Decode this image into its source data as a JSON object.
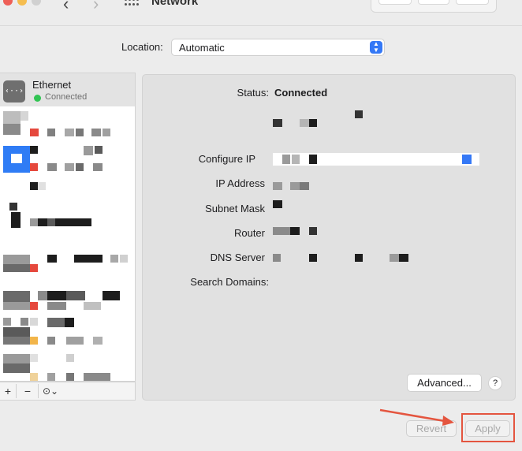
{
  "window": {
    "title": "Network"
  },
  "location": {
    "label": "Location:",
    "value": "Automatic"
  },
  "sidebar": {
    "ethernet": {
      "name": "Ethernet",
      "status": "Connected",
      "icon": "ethernet-icon",
      "status_color": "#31c453"
    },
    "footer": {
      "add": "+",
      "remove": "−",
      "action": "⊙⌄"
    }
  },
  "detail": {
    "status_label": "Status:",
    "status_value": "Connected",
    "configure_label": "Configure IP",
    "ip_label": "IP Address",
    "subnet_label": "Subnet Mask",
    "router_label": "Router",
    "dns_label": "DNS Server",
    "search_label": "Search Domains:",
    "advanced_button": "Advanced...",
    "help_button": "?"
  },
  "actions": {
    "revert": "Revert",
    "apply": "Apply"
  },
  "colors": {
    "accent": "#3478f6",
    "highlight": "#e4553f"
  }
}
